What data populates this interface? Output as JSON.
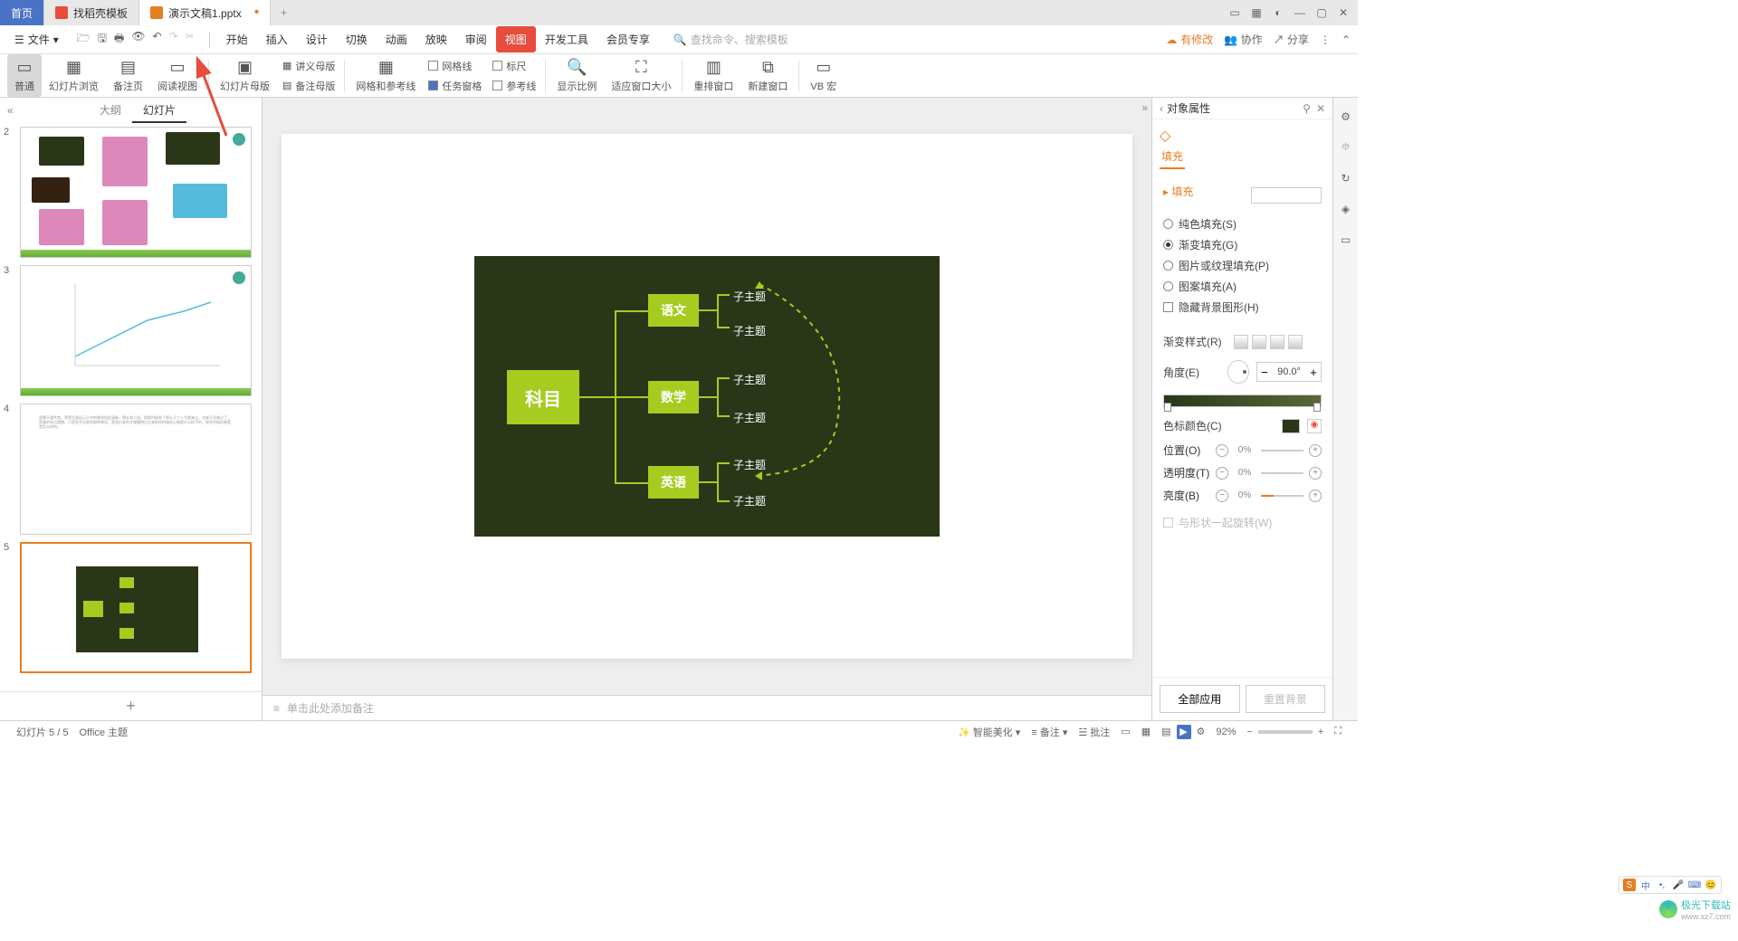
{
  "titlebar": {
    "home": "首页",
    "tab1": "找稻壳模板",
    "tab2": "演示文稿1.pptx"
  },
  "menubar": {
    "file": "文件",
    "tabs": [
      "开始",
      "插入",
      "设计",
      "切换",
      "动画",
      "放映",
      "审阅",
      "视图",
      "开发工具",
      "会员专享"
    ],
    "active_tab": "视图",
    "search_hint": "查找命令、搜索模板",
    "pending": "有修改",
    "coop": "协作",
    "share": "分享"
  },
  "ribbon": {
    "normal": "普通",
    "browse": "幻灯片浏览",
    "notes": "备注页",
    "reading": "阅读视图",
    "master": "幻灯片母版",
    "handout_master": "讲义母版",
    "notes_master": "备注母版",
    "grid_guides": "网格和参考线",
    "gridlines": "网格线",
    "ruler": "标尺",
    "taskpane": "任务窗格",
    "guides": "参考线",
    "zoom": "显示比例",
    "fit": "适应窗口大小",
    "arrange": "重排窗口",
    "newwin": "新建窗口",
    "macro": "VB 宏"
  },
  "slidepanel": {
    "outline": "大纲",
    "slides": "幻灯片"
  },
  "mindmap": {
    "root": "科目",
    "branches": [
      "语文",
      "数学",
      "英语"
    ],
    "leaf": "子主题"
  },
  "notes_placeholder": "单击此处添加备注",
  "props": {
    "title": "对象属性",
    "fill_tab": "填充",
    "fill_section": "填充",
    "solid": "纯色填充(S)",
    "gradient": "渐变填充(G)",
    "picture": "图片或纹理填充(P)",
    "pattern": "图案填充(A)",
    "hidebg": "隐藏背景图形(H)",
    "gradstyle": "渐变样式(R)",
    "angle": "角度(E)",
    "angle_val": "90.0°",
    "stopcolor": "色标颜色(C)",
    "position": "位置(O)",
    "pos_val": "0%",
    "transparency": "透明度(T)",
    "trans_val": "0%",
    "brightness": "亮度(B)",
    "bright_val": "0%",
    "rotate_with": "与形状一起旋转(W)",
    "apply_all": "全部应用",
    "reset_bg": "重置背景"
  },
  "statusbar": {
    "slide_info": "幻灯片 5 / 5",
    "theme": "Office 主题",
    "beautify": "智能美化",
    "notes": "备注",
    "comments": "批注",
    "zoom": "92%"
  },
  "watermark": "极光下载站"
}
